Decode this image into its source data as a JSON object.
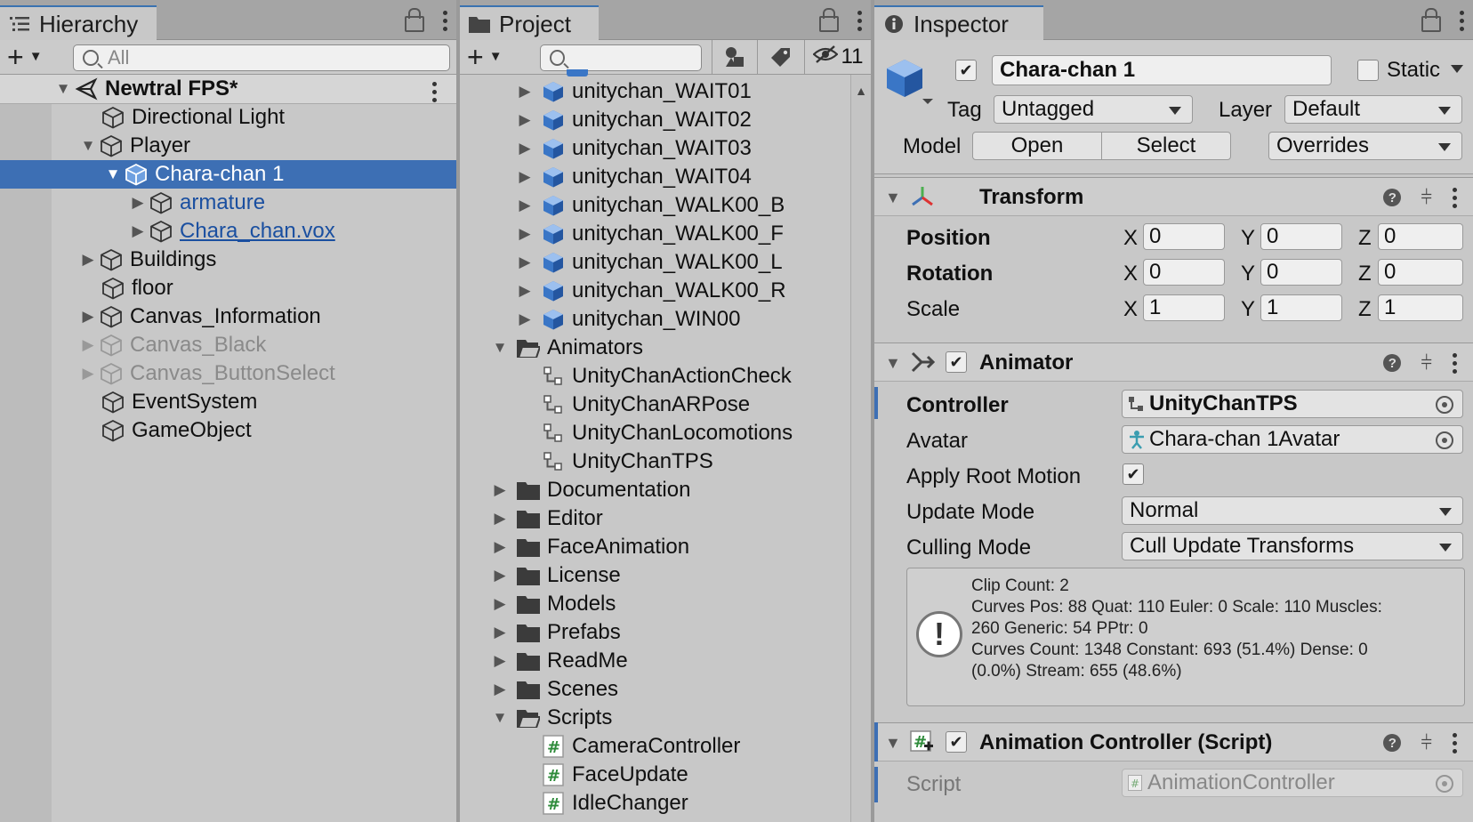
{
  "hierarchy": {
    "tab_label": "Hierarchy",
    "search_placeholder": "All",
    "scene_name": "Newtral FPS*",
    "items": [
      {
        "label": "Directional Light"
      },
      {
        "label": "Player"
      },
      {
        "label": "Chara-chan 1"
      },
      {
        "label": "armature"
      },
      {
        "label": "Chara_chan.vox"
      },
      {
        "label": "Buildings"
      },
      {
        "label": "floor"
      },
      {
        "label": "Canvas_Information"
      },
      {
        "label": "Canvas_Black"
      },
      {
        "label": "Canvas_ButtonSelect"
      },
      {
        "label": "EventSystem"
      },
      {
        "label": "GameObject"
      }
    ]
  },
  "project": {
    "tab_label": "Project",
    "search_placeholder": "",
    "hidden_count": "11",
    "items": [
      {
        "label": "unitychan_WAIT01"
      },
      {
        "label": "unitychan_WAIT02"
      },
      {
        "label": "unitychan_WAIT03"
      },
      {
        "label": "unitychan_WAIT04"
      },
      {
        "label": "unitychan_WALK00_B"
      },
      {
        "label": "unitychan_WALK00_F"
      },
      {
        "label": "unitychan_WALK00_L"
      },
      {
        "label": "unitychan_WALK00_R"
      },
      {
        "label": "unitychan_WIN00"
      },
      {
        "label": "Animators"
      },
      {
        "label": "UnityChanActionCheck"
      },
      {
        "label": "UnityChanARPose"
      },
      {
        "label": "UnityChanLocomotions"
      },
      {
        "label": "UnityChanTPS"
      },
      {
        "label": "Documentation"
      },
      {
        "label": "Editor"
      },
      {
        "label": "FaceAnimation"
      },
      {
        "label": "License"
      },
      {
        "label": "Models"
      },
      {
        "label": "Prefabs"
      },
      {
        "label": "ReadMe"
      },
      {
        "label": "Scenes"
      },
      {
        "label": "Scripts"
      },
      {
        "label": "CameraController"
      },
      {
        "label": "FaceUpdate"
      },
      {
        "label": "IdleChanger"
      }
    ]
  },
  "inspector": {
    "tab_label": "Inspector",
    "object_name": "Chara-chan 1",
    "static_label": "Static",
    "tag_label": "Tag",
    "tag_value": "Untagged",
    "layer_label": "Layer",
    "layer_value": "Default",
    "model_label": "Model",
    "open_label": "Open",
    "select_label": "Select",
    "overrides_label": "Overrides",
    "transform": {
      "title": "Transform",
      "position_label": "Position",
      "rotation_label": "Rotation",
      "scale_label": "Scale",
      "x": "X",
      "y": "Y",
      "z": "Z",
      "position": [
        "0",
        "0",
        "0"
      ],
      "rotation": [
        "0",
        "0",
        "0"
      ],
      "scale": [
        "1",
        "1",
        "1"
      ]
    },
    "animator": {
      "title": "Animator",
      "controller_label": "Controller",
      "controller_value": "UnityChanTPS",
      "avatar_label": "Avatar",
      "avatar_value": "Chara-chan 1Avatar",
      "apply_root_motion_label": "Apply Root Motion",
      "update_mode_label": "Update Mode",
      "update_mode_value": "Normal",
      "culling_mode_label": "Culling Mode",
      "culling_mode_value": "Cull Update Transforms",
      "info_lines": [
        "Clip Count: 2",
        "Curves Pos: 88 Quat: 110 Euler: 0 Scale: 110 Muscles:",
        "260 Generic: 54 PPtr: 0",
        "Curves Count: 1348 Constant: 693 (51.4%) Dense: 0",
        "(0.0%) Stream: 655 (48.6%)"
      ]
    },
    "script_component": {
      "title": "Animation Controller (Script)",
      "script_label": "Script",
      "script_value": "AnimationController"
    }
  },
  "colors": {
    "selection": "#3d6fb4",
    "prefab_text": "#1a4fa0",
    "script_icon": "#2e8b3a"
  }
}
